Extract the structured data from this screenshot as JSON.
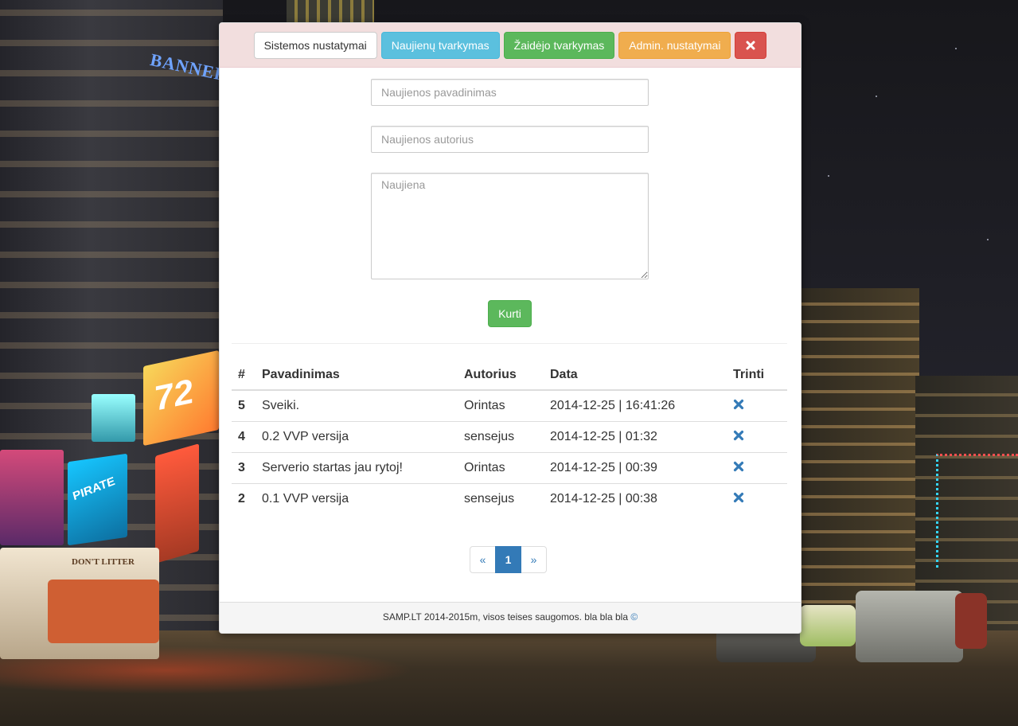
{
  "colors": {
    "header_bg": "#f2dede",
    "default": "#ffffff",
    "info": "#5bc0de",
    "success": "#5cb85c",
    "warning": "#f0ad4e",
    "danger": "#d9534f",
    "link": "#337ab7"
  },
  "toolbar": {
    "system_settings_label": "Sistemos nustatymai",
    "news_management_label": "Naujienų tvarkymas",
    "player_management_label": "Žaidėjo tvarkymas",
    "admin_settings_label": "Admin. nustatymai",
    "close_icon": "close-icon"
  },
  "form": {
    "title_placeholder": "Naujienos pavadinimas",
    "title_value": "",
    "author_placeholder": "Naujienos autorius",
    "author_value": "",
    "body_placeholder": "Naujiena",
    "body_value": "",
    "submit_label": "Kurti"
  },
  "table": {
    "headers": [
      "#",
      "Pavadinimas",
      "Autorius",
      "Data",
      "Trinti"
    ],
    "rows": [
      {
        "id": "5",
        "title": "Sveiki.",
        "author": "Orintas",
        "date": "2014-12-25 | 16:41:26",
        "delete_icon": "delete-icon"
      },
      {
        "id": "4",
        "title": "0.2 VVP versija",
        "author": "sensejus",
        "date": "2014-12-25 | 01:32",
        "delete_icon": "delete-icon"
      },
      {
        "id": "3",
        "title": "Serverio startas jau rytoj!",
        "author": "Orintas",
        "date": "2014-12-25 | 00:39",
        "delete_icon": "delete-icon"
      },
      {
        "id": "2",
        "title": "0.1 VVP versija",
        "author": "sensejus",
        "date": "2014-12-25 | 00:38",
        "delete_icon": "delete-icon"
      }
    ]
  },
  "pagination": {
    "prev": "«",
    "current": "1",
    "next": "»"
  },
  "footer": {
    "text": "SAMP.LT 2014-2015m, visos teises saugomos. bla bla bla",
    "copyright_symbol": "©"
  }
}
